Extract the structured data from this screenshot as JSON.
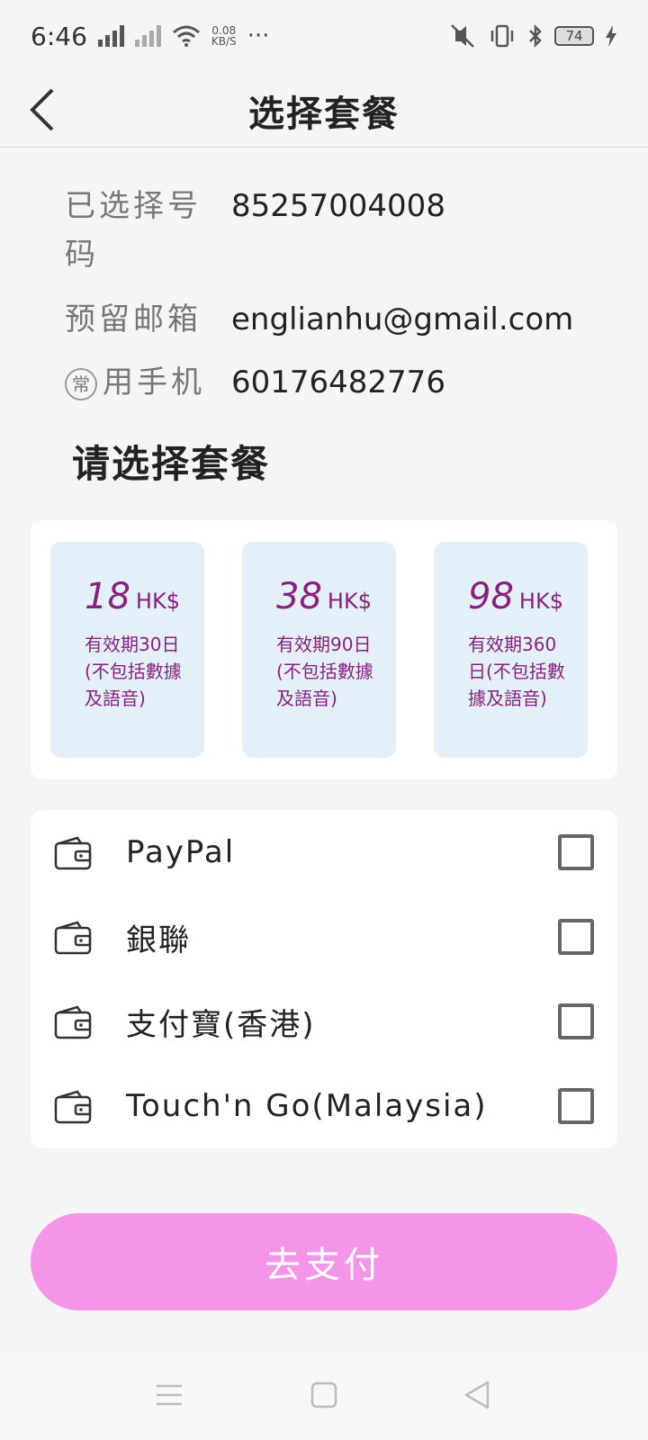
{
  "status_bar": {
    "time": "6:46",
    "speed_value": "0.08",
    "speed_unit": "KB/S",
    "more": "···",
    "battery": "74"
  },
  "header": {
    "title": "选择套餐",
    "back_icon": "chevron-left-icon"
  },
  "info": {
    "number_label": "已选择号码",
    "number_value": "85257004008",
    "email_label": "预留邮箱",
    "email_value": "englianhu@gmail.com",
    "phone_label_circle": "常",
    "phone_label_rest": "用手机",
    "phone_value": "60176482776"
  },
  "section_title": "请选择套餐",
  "plans": [
    {
      "price": "18",
      "currency": "HK$",
      "desc": "有效期30日(不包括數據及語音)"
    },
    {
      "price": "38",
      "currency": "HK$",
      "desc": "有效期90日(不包括數據及語音)"
    },
    {
      "price": "98",
      "currency": "HK$",
      "desc": "有效期360日(不包括數據及語音)"
    }
  ],
  "payment_methods": [
    {
      "label": "PayPal",
      "icon": "wallet-icon",
      "checked": false
    },
    {
      "label": "銀聯",
      "icon": "wallet-icon",
      "checked": false
    },
    {
      "label": "支付寶(香港)",
      "icon": "wallet-icon",
      "checked": false
    },
    {
      "label": "Touch'n Go(Malaysia)",
      "icon": "wallet-icon",
      "checked": false
    }
  ],
  "pay_button_label": "去支付",
  "colors": {
    "accent_pink": "#f595e8",
    "plan_bg": "#e3f0f7",
    "plan_text": "#8b1f7f"
  }
}
